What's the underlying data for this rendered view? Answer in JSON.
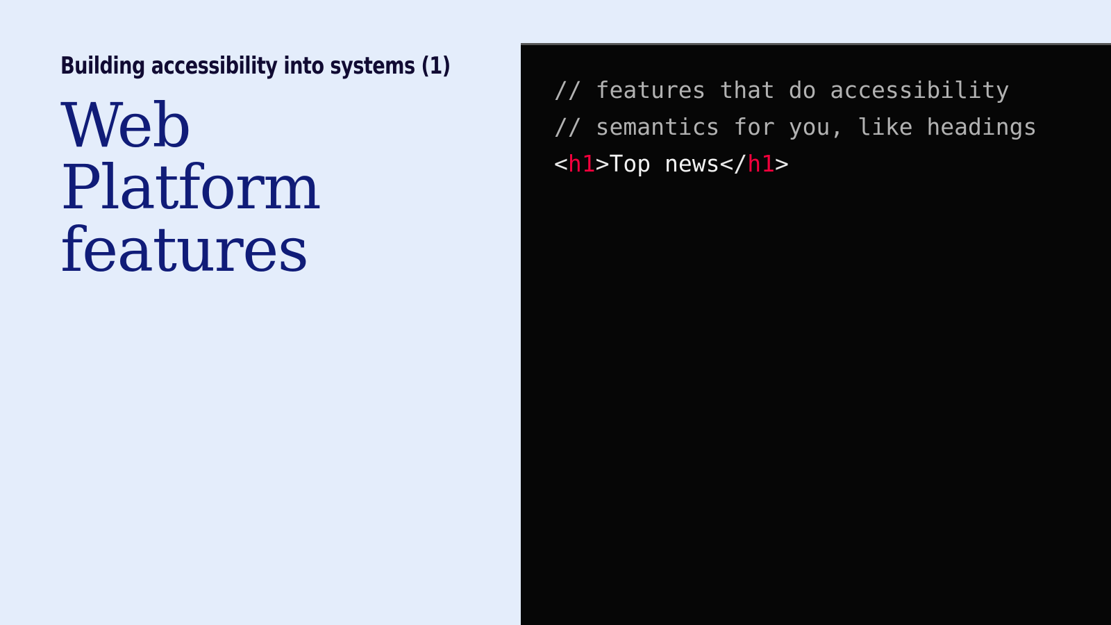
{
  "slide": {
    "background_color": "#e4edfb",
    "kicker": "Building accessibility into systems (1)",
    "title": "Web Platform features",
    "title_color": "#101c78",
    "kicker_color": "#110b33"
  },
  "code_panel": {
    "background_color": "#060606",
    "border_color": "#565656",
    "language": "html",
    "comment_color": "#b2b2b2",
    "tag_color": "#f2003c",
    "punct_color": "#e9e9e9",
    "lines": [
      {
        "id": "line-1",
        "full_text": "// features that do accessibility",
        "tokens": [
          {
            "kind": "comment",
            "text": "// features that do accessibility"
          }
        ]
      },
      {
        "id": "line-2",
        "full_text": "// semantics for you, like headings",
        "tokens": [
          {
            "kind": "comment",
            "text": "// semantics for you, like headings"
          }
        ]
      },
      {
        "id": "line-3",
        "full_text": "<h1>Top news</h1>",
        "tokens": [
          {
            "kind": "punct",
            "text": "<"
          },
          {
            "kind": "tag",
            "text": "h1"
          },
          {
            "kind": "punct",
            "text": ">"
          },
          {
            "kind": "text",
            "text": "Top news"
          },
          {
            "kind": "punct",
            "text": "</"
          },
          {
            "kind": "tag",
            "text": "h1"
          },
          {
            "kind": "punct",
            "text": ">"
          }
        ]
      }
    ]
  }
}
